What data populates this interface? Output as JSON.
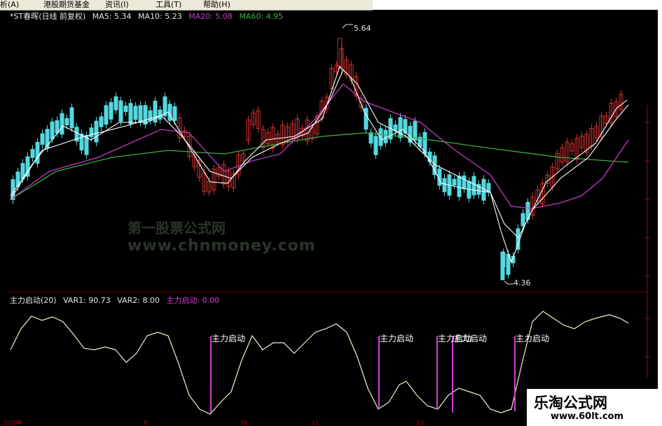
{
  "menu": {
    "items": [
      "析(A)",
      "港股期货基金",
      "资讯(I)",
      "工具(T)",
      "帮助(H)"
    ]
  },
  "main_chart": {
    "title": "*ST春晖(日线 前复权)",
    "ma5": "MA5: 5.34",
    "ma10": "MA10: 5.23",
    "ma20": "MA20: 5.08",
    "ma60": "MA60: 4.95",
    "high_label": "5.64",
    "low_label": "4.36"
  },
  "indicator": {
    "name": "主力启动(20)",
    "var1": "VAR1: 90.73",
    "var2": "VAR2: 8.00",
    "signal": "主力启动: 0.00",
    "signal_label": "主力启动"
  },
  "watermark": {
    "line1": "第一股票公式网",
    "line2": "www.chnmoney.com"
  },
  "brand": {
    "title": "乐淘公式网",
    "url": "www.60lt.com"
  },
  "time_axis": {
    "labels": [
      "2010年",
      "9",
      "10",
      "11",
      "12"
    ]
  },
  "colors": {
    "up": "#d03030",
    "down": "#54d8e0",
    "ma5": "#ffffff",
    "ma10": "#ffffff",
    "ma20": "#c03cc0",
    "ma60": "#3cb040",
    "signal": "#d040d0",
    "var1": "#f4f0c8"
  },
  "chart_data": {
    "type": "candlestick",
    "series": [
      {
        "name": "MA20",
        "values": [
          5.08
        ]
      },
      {
        "name": "MA60",
        "values": [
          4.95
        ]
      },
      {
        "name": "MA5",
        "values": [
          5.34
        ]
      },
      {
        "name": "MA10",
        "values": [
          5.23
        ]
      }
    ],
    "annotations": {
      "high": 5.64,
      "low": 4.36
    },
    "indicator": {
      "name": "主力启动(20)",
      "var1": 90.73,
      "var2": 8.0,
      "signal": 0.0
    }
  }
}
